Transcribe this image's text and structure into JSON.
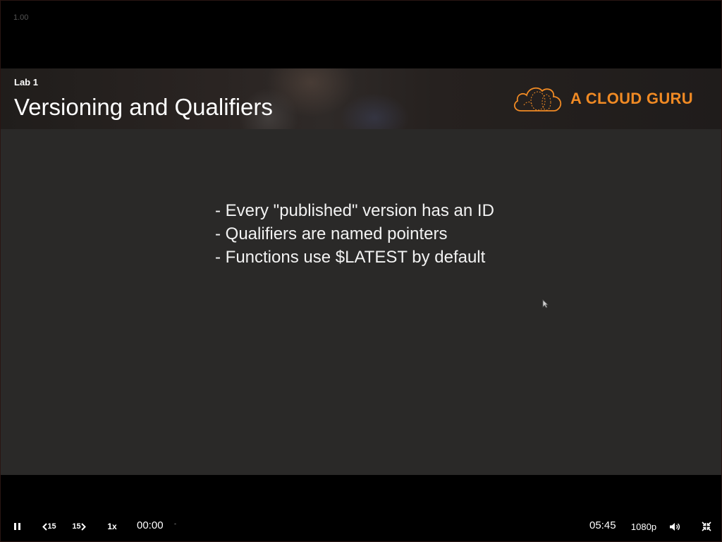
{
  "player": {
    "zoom_readout": "1.00"
  },
  "slide": {
    "lab_label": "Lab 1",
    "title": "Versioning and Qualifiers",
    "logo_text": "A CLOUD GURU",
    "bullets": [
      "- Every \"published\" version has an ID",
      "- Qualifiers are named pointers",
      "- Functions use $LATEST by default"
    ],
    "brand_color": "#f08a24"
  },
  "controls": {
    "pause_icon": "pause-icon",
    "skip_back_label": "15",
    "skip_forward_label": "15",
    "speed_label": "1x",
    "current_time": "00:00",
    "separator": "-",
    "total_time": "05:45",
    "quality_label": "1080p",
    "volume_icon": "volume-icon",
    "exit_fullscreen_icon": "exit-fullscreen-icon"
  }
}
